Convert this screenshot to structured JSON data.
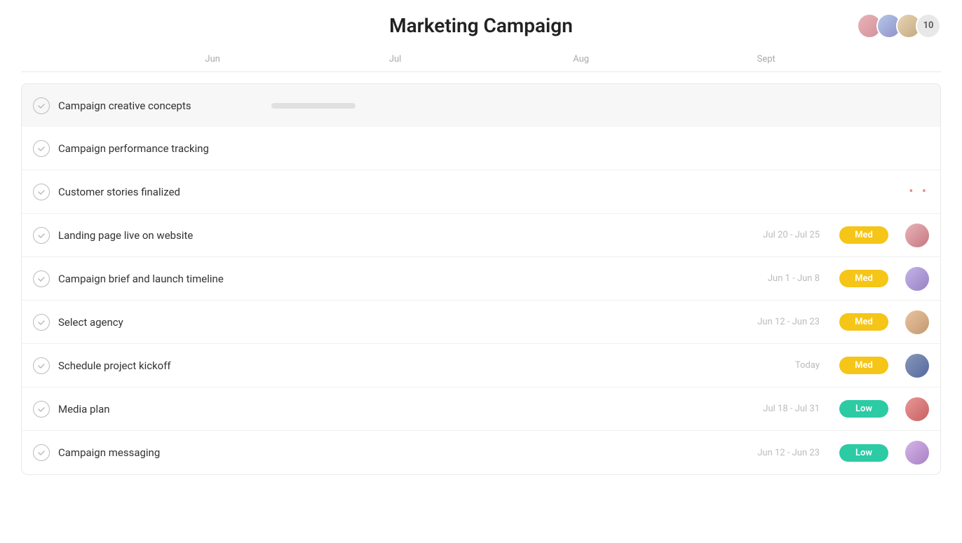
{
  "header": {
    "title": "Marketing Campaign",
    "avatar_count": "10"
  },
  "timeline": {
    "months": [
      "Jun",
      "Jul",
      "Aug",
      "Sept"
    ]
  },
  "tasks": [
    {
      "id": 1,
      "name": "Campaign creative concepts",
      "date": "",
      "priority": "",
      "priority_type": "",
      "avatar_class": "",
      "highlighted": true,
      "has_gantt": true
    },
    {
      "id": 2,
      "name": "Campaign performance tracking",
      "date": "",
      "priority": "",
      "priority_type": "",
      "avatar_class": "",
      "highlighted": false,
      "has_gantt": false
    },
    {
      "id": 3,
      "name": "Customer stories finalized",
      "date": "",
      "priority": "",
      "priority_type": "",
      "avatar_class": "",
      "highlighted": false,
      "has_dots": true
    },
    {
      "id": 4,
      "name": "Landing page live on website",
      "date": "Jul 20 - Jul 25",
      "priority": "Med",
      "priority_type": "med",
      "avatar_class": "av1",
      "highlighted": false
    },
    {
      "id": 5,
      "name": "Campaign brief and launch timeline",
      "date": "Jun 1 - Jun 8",
      "priority": "Med",
      "priority_type": "med",
      "avatar_class": "av2",
      "highlighted": false
    },
    {
      "id": 6,
      "name": "Select agency",
      "date": "Jun 12 - Jun 23",
      "priority": "Med",
      "priority_type": "med",
      "avatar_class": "av3",
      "highlighted": false
    },
    {
      "id": 7,
      "name": "Schedule project kickoff",
      "date": "Today",
      "priority": "Med",
      "priority_type": "med",
      "avatar_class": "av4",
      "highlighted": false
    },
    {
      "id": 8,
      "name": "Media plan",
      "date": "Jul 18 - Jul 31",
      "priority": "Low",
      "priority_type": "low",
      "avatar_class": "av5",
      "highlighted": false
    },
    {
      "id": 9,
      "name": "Campaign messaging",
      "date": "Jun 12 - Jun 23",
      "priority": "Low",
      "priority_type": "low",
      "avatar_class": "av6",
      "highlighted": false
    }
  ],
  "labels": {
    "checkmark": "✓",
    "med": "Med",
    "low": "Low"
  }
}
